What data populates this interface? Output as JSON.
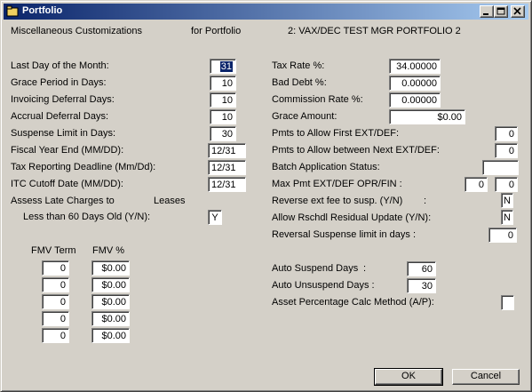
{
  "window": {
    "title": "Portfolio",
    "minimize_symbol": "_",
    "maximize_symbol": "□",
    "close_symbol": "×"
  },
  "header": {
    "section": "Miscellaneous Customizations",
    "for_label": "for Portfolio",
    "portfolio": "2: VAX/DEC TEST MGR PORTFOLIO 2"
  },
  "left": {
    "last_day_label": "Last Day of the Month:",
    "last_day_value": "31",
    "grace_label": "Grace Period in Days:",
    "grace_value": "10",
    "invoicing_label": "Invoicing Deferral Days:",
    "invoicing_value": "10",
    "accrual_label": "Accrual Deferral Days:",
    "accrual_value": "10",
    "suspense_label": "Suspense Limit in Days:",
    "suspense_value": "30",
    "fiscal_label": "Fiscal Year End (MM/DD):",
    "fiscal_value": "12/31",
    "tax_deadline_label": "Tax Reporting Deadline (Mm/Dd):",
    "tax_deadline_value": "12/31",
    "itc_label": "ITC Cutoff Date (MM/DD):",
    "itc_value": "12/31",
    "assess_label": "Assess Late Charges to",
    "leases_label": "Leases",
    "less60_label": "Less than 60 Days Old (Y/N):",
    "less60_value": "Y"
  },
  "fmv": {
    "term_header": "FMV Term",
    "pct_header": "FMV %",
    "rows": [
      {
        "term": "0",
        "pct": "$0.00"
      },
      {
        "term": "0",
        "pct": "$0.00"
      },
      {
        "term": "0",
        "pct": "$0.00"
      },
      {
        "term": "0",
        "pct": "$0.00"
      },
      {
        "term": "0",
        "pct": "$0.00"
      }
    ]
  },
  "right": {
    "tax_rate_label": "Tax Rate %:",
    "tax_rate_value": "34.00000",
    "bad_debt_label": "Bad Debt %:",
    "bad_debt_value": "0.00000",
    "commission_label": "Commission Rate %:",
    "commission_value": "0.00000",
    "grace_amount_label": "Grace Amount:",
    "grace_amount_value": "$0.00",
    "pmts_first_label": "Pmts to Allow First EXT/DEF:",
    "pmts_first_value": "0",
    "pmts_between_label": "Pmts to Allow between Next EXT/DEF:",
    "pmts_between_value": "0",
    "batch_label": "Batch Application Status:",
    "batch_value": "",
    "max_pmt_label": "Max Pmt EXT/DEF OPR/FIN :",
    "max_pmt_opr": "0",
    "max_pmt_fin": "0",
    "reverse_fee_label": "Reverse ext fee to susp. (Y/N)",
    "reverse_fee_colon": ":",
    "reverse_fee_value": "N",
    "allow_rschdl_label": "Allow Rschdl Residual Update (Y/N):",
    "allow_rschdl_value": "N",
    "reversal_limit_label": "Reversal Suspense limit in days :",
    "reversal_limit_value": "0",
    "auto_suspend_label": "Auto Suspend Days",
    "auto_suspend_colon": ":",
    "auto_suspend_value": "60",
    "auto_unsuspend_label": "Auto Unsuspend Days :",
    "auto_unsuspend_value": "30",
    "asset_pct_label": "Asset Percentage Calc Method (A/P):",
    "asset_pct_value": ""
  },
  "buttons": {
    "ok": "OK",
    "cancel": "Cancel"
  }
}
